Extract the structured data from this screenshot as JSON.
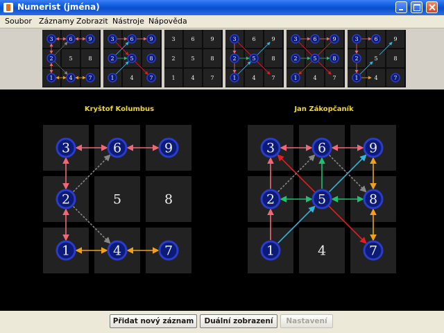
{
  "window": {
    "title": "Numerist (jména)"
  },
  "menu": [
    "Soubor",
    "Záznamy",
    "Zobrazit",
    "Nástroje",
    "Nápověda"
  ],
  "panels": [
    {
      "name": "Kryštof Kolumbus"
    },
    {
      "name": "Jan Zákopčaník"
    }
  ],
  "grid_digits": [
    "3",
    "6",
    "9",
    "2",
    "5",
    "8",
    "1",
    "4",
    "7"
  ],
  "buttons": {
    "add": "Přidat nový záznam",
    "dual": "Duální zobrazení",
    "settings": "Nastavení"
  },
  "colors": {
    "accent_title": "#f0d830",
    "pink": "#f06878",
    "orange": "#f0a020",
    "cyan": "#30b8e0",
    "green": "#20c070",
    "red": "#e02020",
    "gray": "#888888"
  }
}
